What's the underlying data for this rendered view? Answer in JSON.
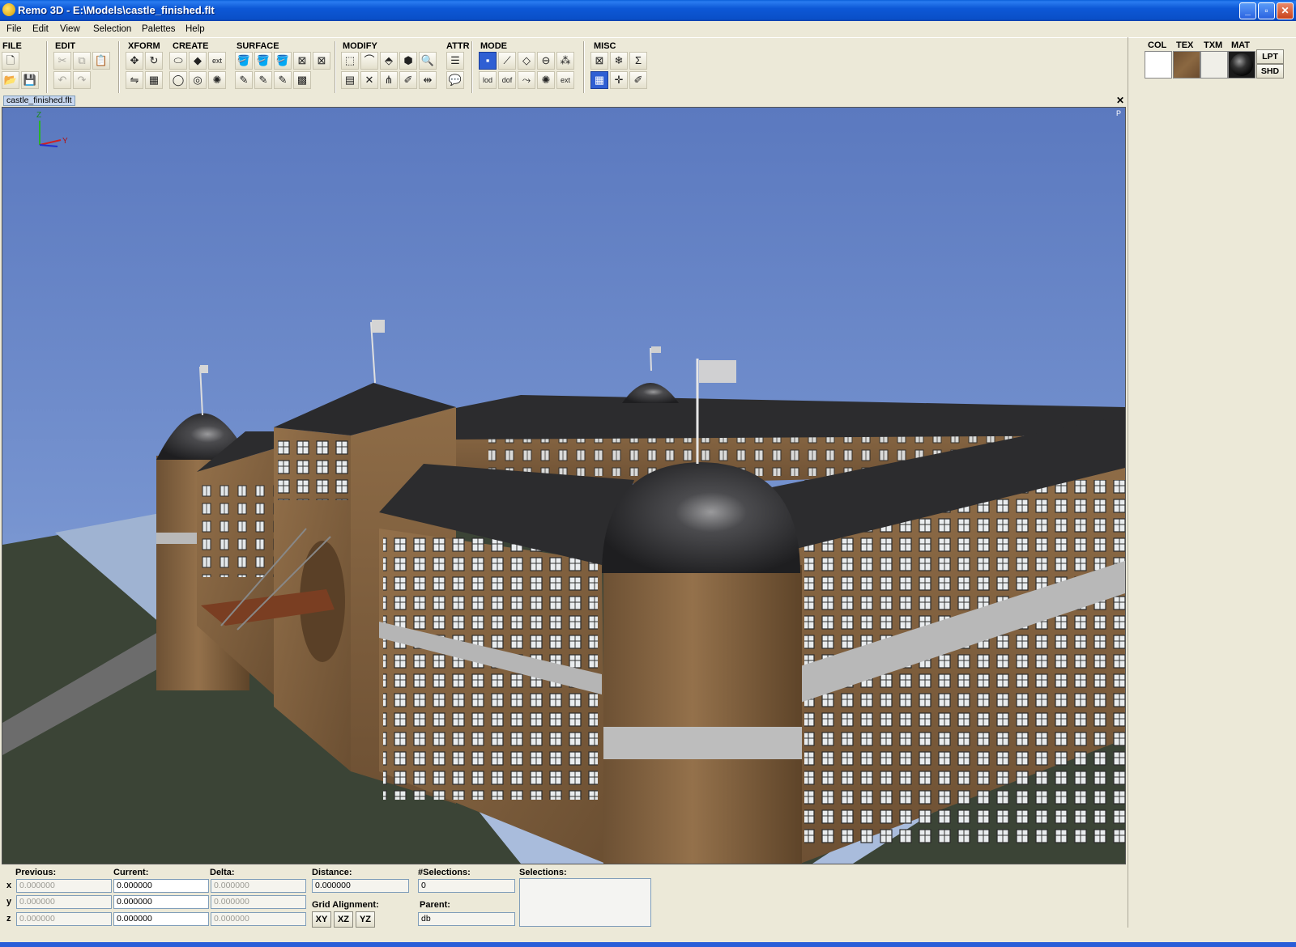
{
  "window": {
    "title": "Remo 3D - E:\\Models\\castle_finished.flt"
  },
  "menu": [
    "File",
    "Edit",
    "View",
    "Selection",
    "Palettes",
    "Help"
  ],
  "toolbar": {
    "groups": [
      "FILE",
      "EDIT",
      "XFORM",
      "CREATE",
      "SURFACE",
      "MODIFY",
      "ATTR",
      "MODE",
      "MISC"
    ],
    "icons": {
      "new": "new-file-icon",
      "open": "open-folder-icon",
      "save": "save-disk-icon",
      "cut": "scissors-icon",
      "copy": "copy-icon",
      "paste": "paste-icon",
      "undo": "undo-icon",
      "redo": "redo-icon",
      "move": "move-arrows-icon",
      "rotate": "rotate-icon",
      "scale": "scale-icon",
      "mirror": "mirror-icon",
      "create_object": "create-object-icon",
      "create_face": "create-face-icon",
      "create_ext": "create-ext-icon",
      "sphere": "sphere-icon",
      "cylinder": "cylinder-icon",
      "light": "light-icon",
      "paint": "paint-bucket-icon",
      "texture": "texture-icon",
      "material": "material-icon",
      "clear_texture": "clear-texture-icon",
      "clear_material": "clear-material-icon",
      "attr": "attributes-icon",
      "comment": "comment-icon",
      "mode_vertex": "vertex-mode-icon",
      "mode_edge": "edge-mode-icon",
      "mode_face": "face-mode-icon",
      "mode_object": "object-mode-icon",
      "mode_group": "group-mode-icon",
      "lod": "lod-icon",
      "dof": "dof-icon",
      "ext": "ext-icon",
      "grid": "grid-icon",
      "snowflake": "snowflake-icon",
      "sigma": "sigma-icon"
    },
    "text_icons": {
      "lod": "lod",
      "dof": "dof",
      "ext": "ext",
      "sigma": "Σ"
    }
  },
  "palette": {
    "labels": [
      "COL",
      "TEX",
      "TXM",
      "MAT"
    ],
    "buttons": [
      "LPT",
      "SHD"
    ],
    "colors": {
      "col": "#ffffff",
      "tex": "#7b5a3a",
      "txm": "#f0efe8"
    }
  },
  "document": {
    "tab": "castle_finished.flt",
    "corner": "P"
  },
  "viewport": {
    "axis_labels": {
      "z": "Z",
      "y": "Y"
    }
  },
  "status": {
    "previous": {
      "label": "Previous:",
      "x": "0.000000",
      "y": "0.000000",
      "z": "0.000000"
    },
    "current": {
      "label": "Current:",
      "x": "0.000000",
      "y": "0.000000",
      "z": "0.000000"
    },
    "delta": {
      "label": "Delta:",
      "x": "0.000000",
      "y": "0.000000",
      "z": "0.000000"
    },
    "axes": [
      "x",
      "y",
      "z"
    ],
    "distance": {
      "label": "Distance:",
      "value": "0.000000"
    },
    "grid_alignment": {
      "label": "Grid Alignment:",
      "buttons": [
        "XY",
        "XZ",
        "YZ"
      ]
    },
    "num_selections": {
      "label": "#Selections:",
      "value": "0"
    },
    "parent": {
      "label": "Parent:",
      "value": "db"
    },
    "selections": {
      "label": "Selections:"
    }
  },
  "colors": {
    "accent": "#2f5fd3",
    "sky": "#6a87c8",
    "grass": "#3b4436",
    "roof": "#2c2c2e",
    "wall": "#8c6a44"
  }
}
